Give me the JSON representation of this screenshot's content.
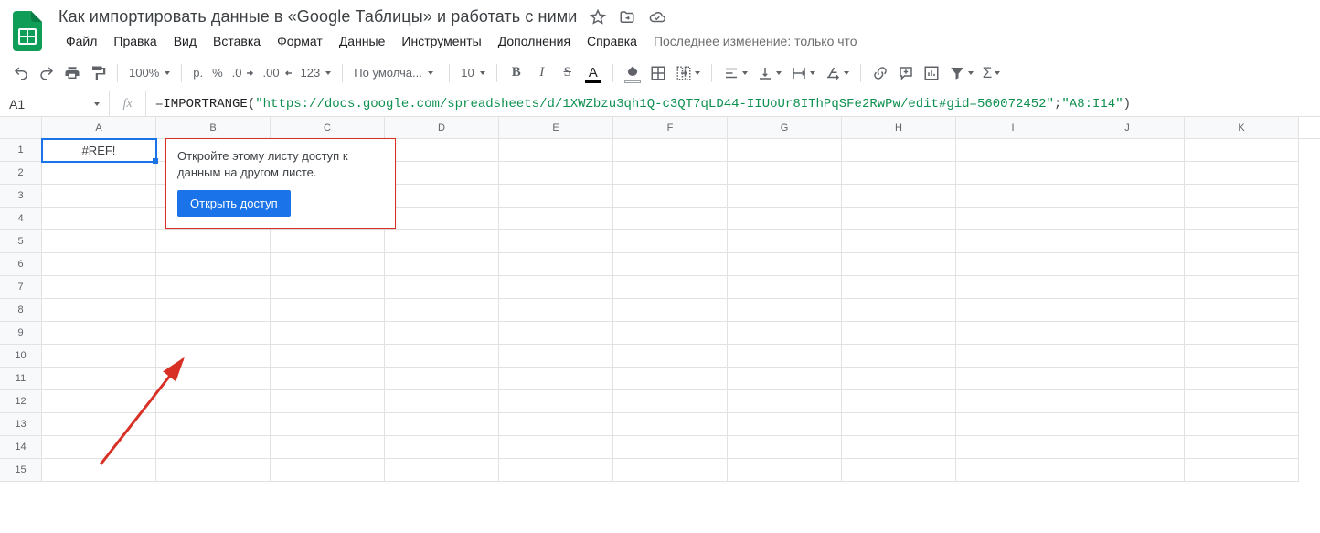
{
  "doc_title": "Как импортировать данные в «Google Таблицы» и работать с ними",
  "last_edit": "Последнее изменение: только что",
  "menus": [
    "Файл",
    "Правка",
    "Вид",
    "Вставка",
    "Формат",
    "Данные",
    "Инструменты",
    "Дополнения",
    "Справка"
  ],
  "toolbar": {
    "zoom": "100%",
    "currency": "р.",
    "percent": "%",
    "dec_dec": ".0",
    "inc_dec": ".00",
    "num_fmt": "123",
    "font": "По умолча...",
    "font_size": "10"
  },
  "namebox": "A1",
  "fx_symbol": "fx",
  "formula_parts": {
    "eq": "=",
    "fn": "IMPORTRANGE",
    "open": "(",
    "url": "\"https://docs.google.com/spreadsheets/d/1XWZbzu3qh1Q-c3QT7qLD44-IIUoUr8IThPqSFe2RwPw/edit#gid=560072452\"",
    "sep": ";",
    "range": "\"A8:I14\"",
    "close": ")"
  },
  "columns": [
    "A",
    "B",
    "C",
    "D",
    "E",
    "F",
    "G",
    "H",
    "I",
    "J",
    "K"
  ],
  "rows": 15,
  "a1_value": "#REF!",
  "popup": {
    "text": "Откройте этому листу доступ к данным на другом листе.",
    "button": "Открыть доступ"
  }
}
